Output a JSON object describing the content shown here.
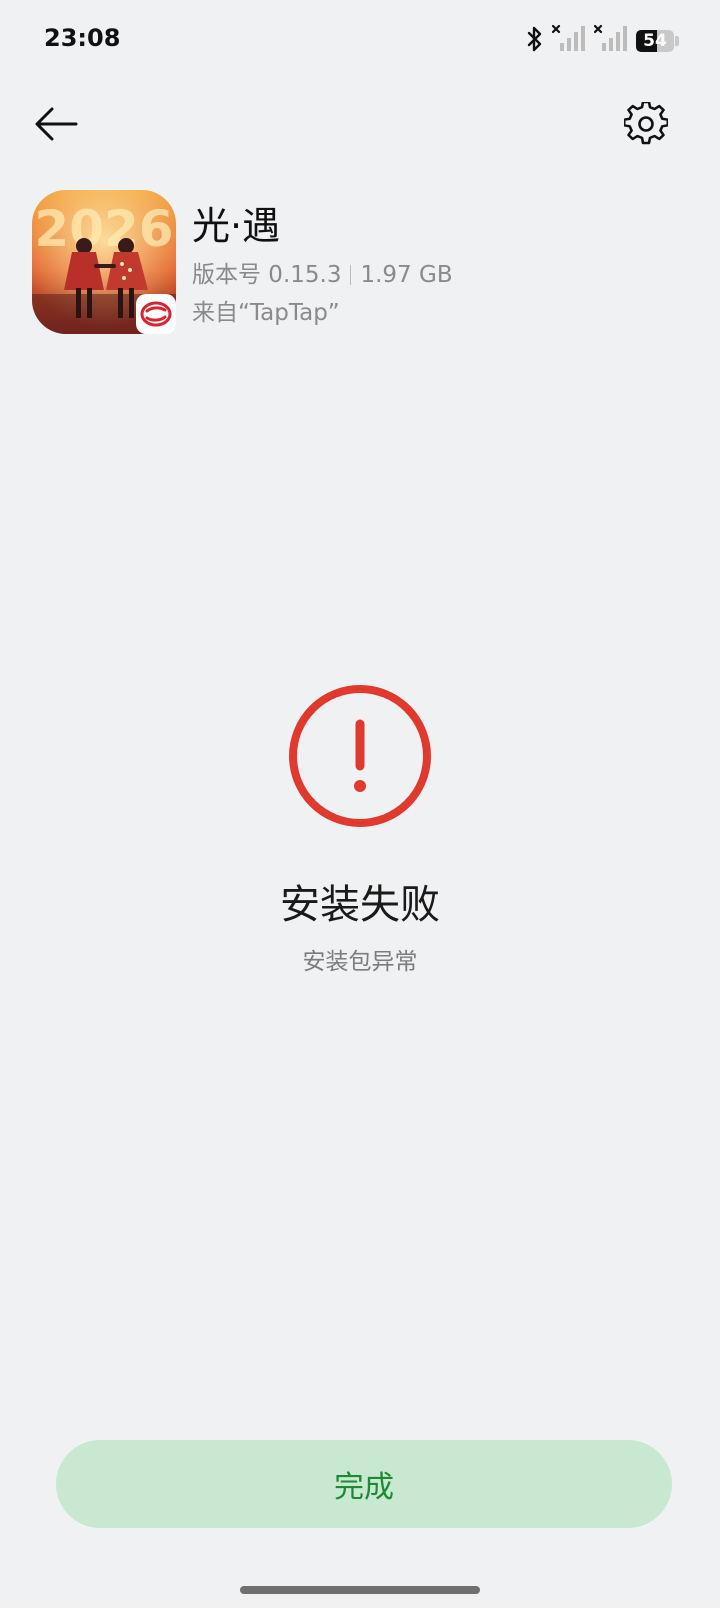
{
  "status_bar": {
    "time": "23:08",
    "battery_level": "54",
    "battery_fraction": 0.54,
    "icons": [
      "bluetooth-icon",
      "signal-no-service-icon",
      "signal-no-service-icon",
      "battery-icon"
    ]
  },
  "top_bar": {
    "back_icon": "back-arrow-icon",
    "settings_icon": "gear-icon"
  },
  "app": {
    "name": "光·遇",
    "version_label": "版本号 0.15.3",
    "size": "1.97 GB",
    "source": "来自“TapTap”",
    "icon_artwork_text": "2026"
  },
  "result": {
    "icon": "error-circle-icon",
    "title": "安装失败",
    "subtitle": "安装包异常"
  },
  "done_button": {
    "label": "完成"
  },
  "colors": {
    "background": "#f0f1f3",
    "error_red": "#e03a2f",
    "button_bg": "#c9e8d2",
    "button_text": "#1b8a30"
  }
}
